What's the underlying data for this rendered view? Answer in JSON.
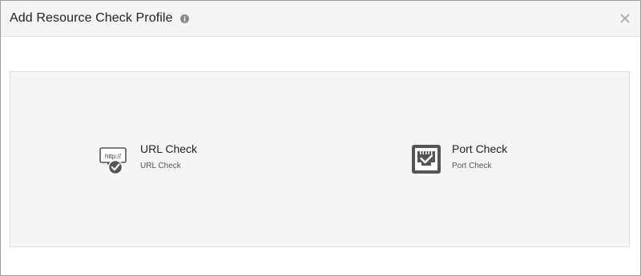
{
  "dialog": {
    "title": "Add Resource Check Profile",
    "info_icon": "info-icon",
    "close_icon": "close-icon"
  },
  "options": [
    {
      "title": "URL Check",
      "subtitle": "URL Check",
      "icon": "url-check-icon",
      "icon_text": "http://"
    },
    {
      "title": "Port Check",
      "subtitle": "Port Check",
      "icon": "port-check-icon"
    }
  ],
  "colors": {
    "header_bg": "#f5f5f5",
    "panel_bg": "#f5f5f5",
    "icon": "#555555",
    "text": "#222222"
  }
}
